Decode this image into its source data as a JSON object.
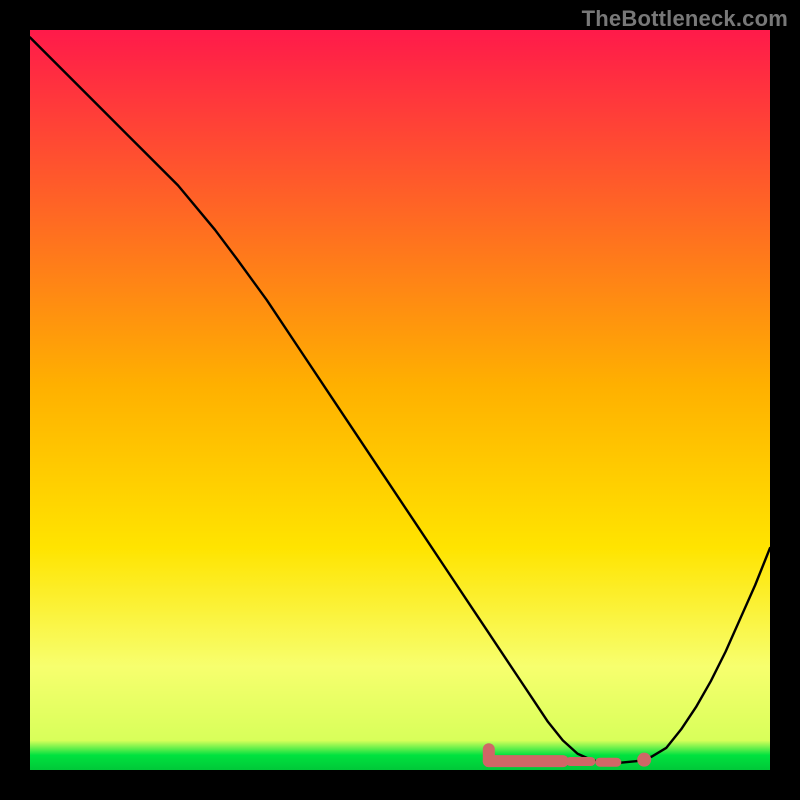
{
  "watermark": "TheBottleneck.com",
  "colors": {
    "bg_black": "#000000",
    "grad_top": "#ff1a4a",
    "grad_mid": "#ffd400",
    "grad_low": "#f7ff6e",
    "grad_green": "#00d63c",
    "curve": "#000000",
    "markers": "#cf6767",
    "watermark": "#787878"
  },
  "chart_data": {
    "type": "line",
    "title": "",
    "xlabel": "",
    "ylabel": "",
    "xlim": [
      0,
      100
    ],
    "ylim": [
      0,
      100
    ],
    "x": [
      0,
      5,
      10,
      15,
      20,
      25,
      28,
      32,
      36,
      40,
      44,
      48,
      52,
      56,
      60,
      62,
      64,
      66,
      68,
      70,
      72,
      74,
      76,
      78,
      80,
      82,
      84,
      86,
      88,
      90,
      92,
      94,
      96,
      98,
      100
    ],
    "values": [
      99,
      94,
      89,
      84,
      79,
      73,
      69,
      63.5,
      57.5,
      51.5,
      45.5,
      39.5,
      33.5,
      27.5,
      21.5,
      18.5,
      15.5,
      12.5,
      9.5,
      6.5,
      4,
      2.2,
      1.3,
      1.0,
      1.0,
      1.2,
      1.8,
      3,
      5.5,
      8.5,
      12,
      16,
      20.5,
      25,
      30
    ],
    "markers": {
      "segment_x": [
        62,
        72
      ],
      "segment_y": [
        2.8,
        1.2
      ],
      "dashes_x": [
        73,
        77
      ],
      "dashes_y": [
        1.15,
        1.05
      ],
      "dot_x": 83,
      "dot_y": 1.4
    },
    "gradient_stops": [
      {
        "pct": 0,
        "color": "#ff1a4a"
      },
      {
        "pct": 48,
        "color": "#ffb000"
      },
      {
        "pct": 70,
        "color": "#ffe400"
      },
      {
        "pct": 86,
        "color": "#f7ff6e"
      },
      {
        "pct": 96,
        "color": "#d8ff5a"
      },
      {
        "pct": 98,
        "color": "#00e23f"
      },
      {
        "pct": 100,
        "color": "#00c838"
      }
    ]
  }
}
